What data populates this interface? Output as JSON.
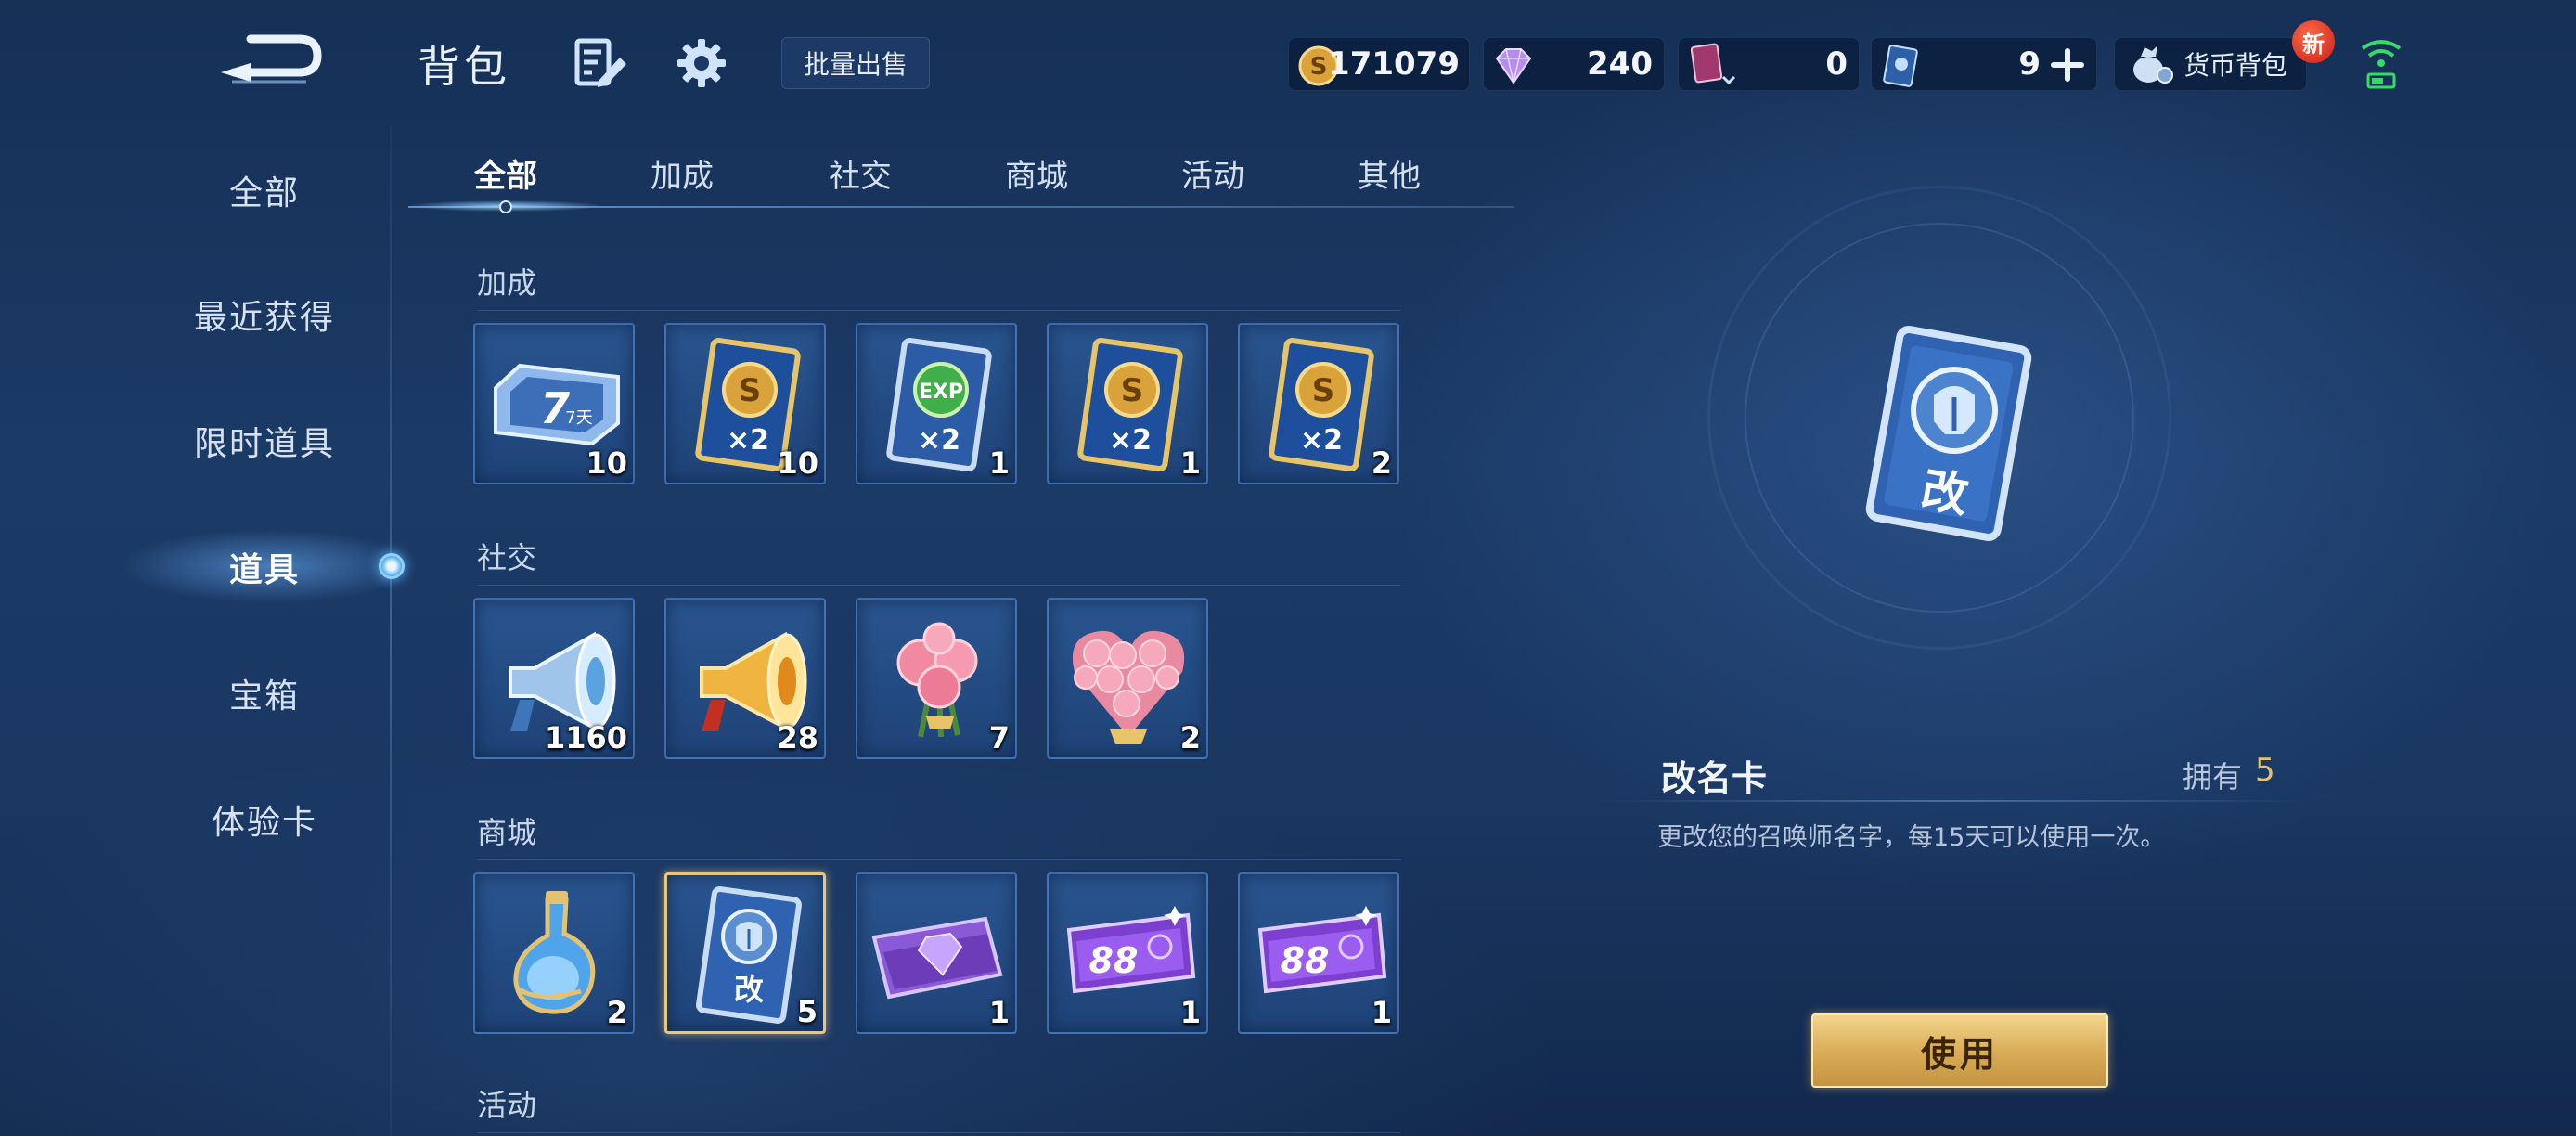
{
  "header": {
    "title": "背包",
    "batch_sell_label": "批量出售",
    "currencies": {
      "gold": "171079",
      "diamond": "240",
      "card": "0",
      "ticket": "9"
    },
    "wallet_label": "货币背包",
    "new_badge": "新"
  },
  "sidebar": {
    "items": [
      {
        "label": "全部"
      },
      {
        "label": "最近获得"
      },
      {
        "label": "限时道具"
      },
      {
        "label": "道具"
      },
      {
        "label": "宝箱"
      },
      {
        "label": "体验卡"
      }
    ],
    "active_index": 3
  },
  "tabs": [
    {
      "label": "全部"
    },
    {
      "label": "加成"
    },
    {
      "label": "社交"
    },
    {
      "label": "商城"
    },
    {
      "label": "活动"
    },
    {
      "label": "其他"
    }
  ],
  "sections": {
    "bonus": {
      "title": "加成",
      "items": [
        {
          "icon": "7-day-card-icon",
          "label": "7天",
          "count": "10"
        },
        {
          "icon": "gold-x2-card-icon",
          "count": "10"
        },
        {
          "icon": "exp-x2-card-icon",
          "count": "1"
        },
        {
          "icon": "gold-x2-card-icon",
          "count": "1"
        },
        {
          "icon": "gold-x2-card-icon",
          "count": "2"
        }
      ]
    },
    "social": {
      "title": "社交",
      "items": [
        {
          "icon": "silver-megaphone-icon",
          "count": "1160"
        },
        {
          "icon": "gold-megaphone-icon",
          "count": "28"
        },
        {
          "icon": "rose-bouquet-icon",
          "count": "7"
        },
        {
          "icon": "heart-rose-bouquet-icon",
          "count": "2"
        }
      ]
    },
    "shop": {
      "title": "商城",
      "items": [
        {
          "icon": "potion-bottle-icon",
          "count": "2"
        },
        {
          "icon": "rename-card-icon",
          "count": "5",
          "selected": true
        },
        {
          "icon": "diamond-ticket-icon",
          "count": "1"
        },
        {
          "icon": "88-ticket-icon",
          "count": "1"
        },
        {
          "icon": "88-ticket-icon",
          "count": "1"
        }
      ]
    },
    "event": {
      "title": "活动"
    }
  },
  "detail": {
    "name": "改名卡",
    "own_label": "拥有",
    "own_count": "5",
    "description": "更改您的召唤师名字，每15天可以使用一次。",
    "use_label": "使用"
  },
  "colors": {
    "accent_gold": "#e8c26a",
    "background": "#1b3a66"
  }
}
